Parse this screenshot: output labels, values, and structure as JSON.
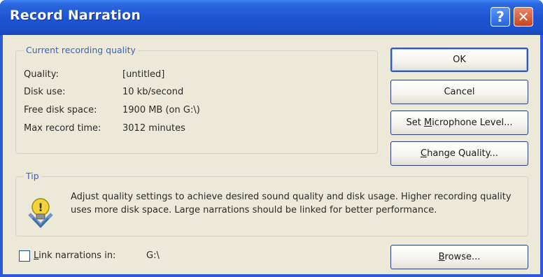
{
  "window": {
    "title": "Record Narration",
    "help_glyph": "?",
    "close_glyph": "✕"
  },
  "quality_group": {
    "legend": "Current recording quality",
    "rows": [
      {
        "label": "Quality:",
        "value": "[untitled]"
      },
      {
        "label": "Disk use:",
        "value": "10 kb/second"
      },
      {
        "label": "Free disk space:",
        "value": "1900 MB (on G:\\)"
      },
      {
        "label": "Max record time:",
        "value": "3012 minutes"
      }
    ]
  },
  "buttons": {
    "ok": "OK",
    "cancel": "Cancel",
    "mic_pre": "Set ",
    "mic_u": "M",
    "mic_post": "icrophone Level...",
    "quality_u": "C",
    "quality_post": "hange Quality...",
    "browse_u": "B",
    "browse_post": "rowse..."
  },
  "tip": {
    "legend": "Tip",
    "text": "Adjust quality settings to achieve desired sound quality and disk usage. Higher recording quality uses more disk space. Large narrations should be linked for better performance.",
    "icon": "lightbulb-icon"
  },
  "link": {
    "label_u": "L",
    "label_post": "ink narrations in:",
    "path": "G:\\",
    "checked": false
  },
  "colors": {
    "titlebar": "#1e55d3",
    "dialog_bg": "#ece9d8",
    "legend_text": "#3a62c4",
    "close_button": "#c9441f"
  }
}
